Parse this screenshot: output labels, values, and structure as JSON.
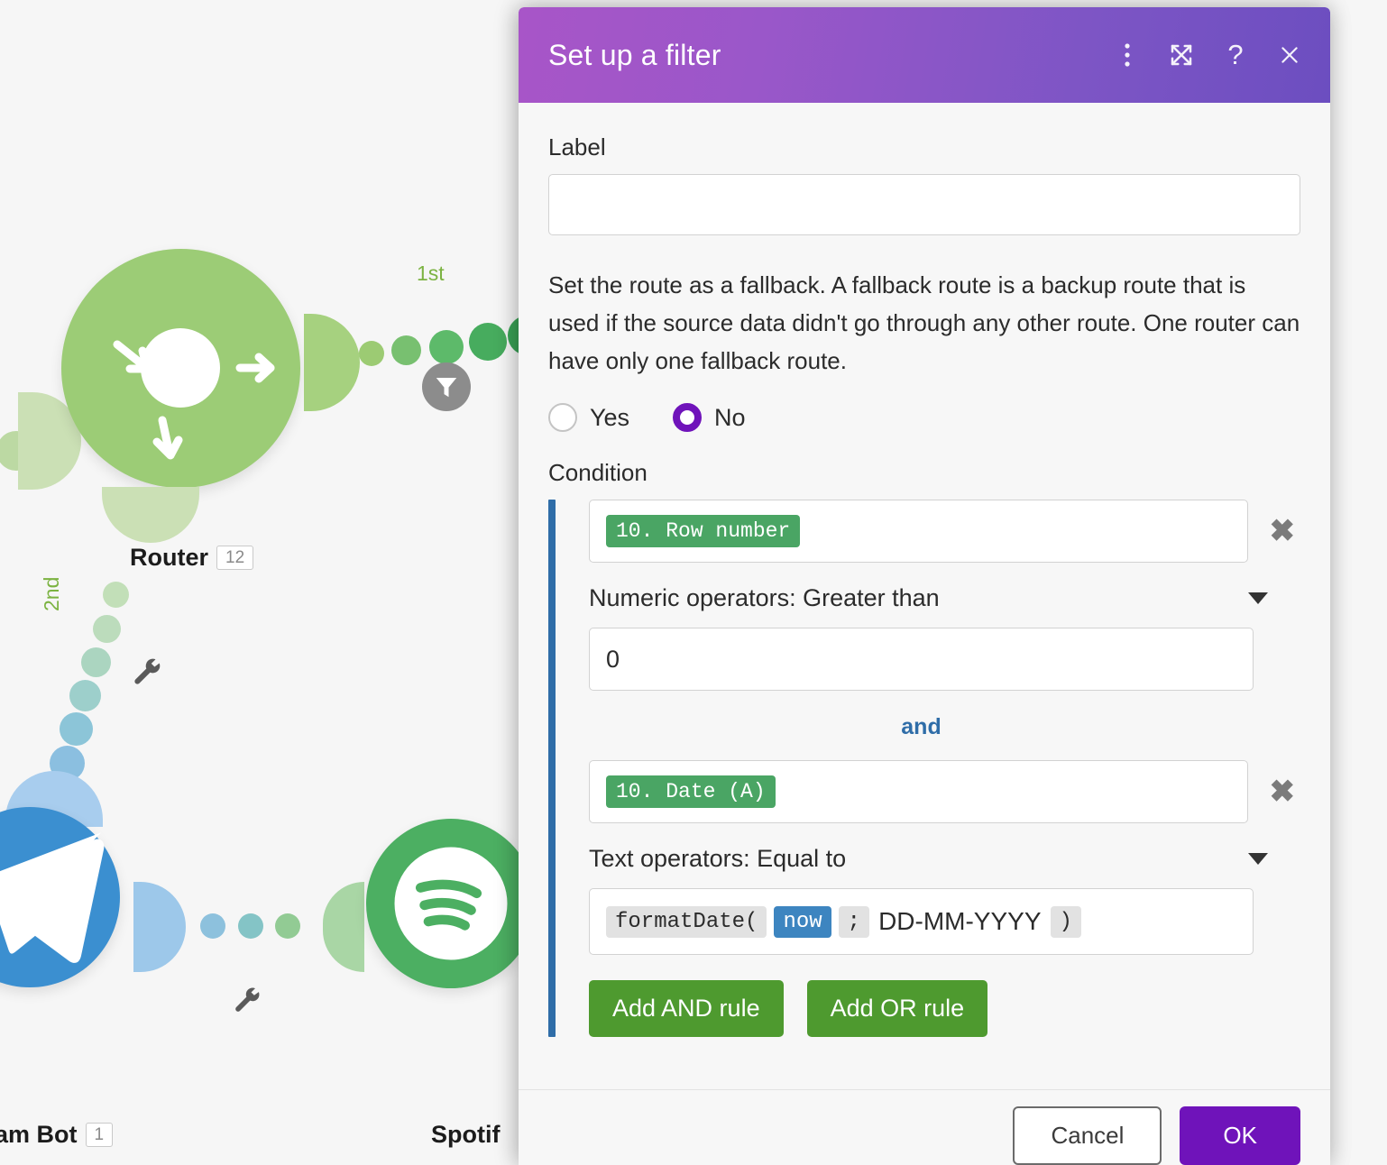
{
  "canvas": {
    "modules": [
      {
        "name": "Router",
        "count": "12",
        "type": "router"
      },
      {
        "name": "am Bot",
        "count": "1",
        "type": "telegram-bot"
      },
      {
        "name": "Spotif",
        "count": "",
        "type": "spotify"
      }
    ],
    "route_labels": [
      "1st",
      "2nd"
    ],
    "filter_icon": "filter-funnel-icon",
    "wrench_icon": "wrench-icon"
  },
  "dialog": {
    "title": "Set up a filter",
    "header_icons": [
      {
        "name": "more-options-icon",
        "glyph": "⋮"
      },
      {
        "name": "expand-icon",
        "glyph": "expand"
      },
      {
        "name": "help-icon",
        "glyph": "?"
      },
      {
        "name": "close-icon",
        "glyph": "×"
      }
    ],
    "label_field": {
      "label": "Label",
      "value": "",
      "placeholder": ""
    },
    "fallback": {
      "description": "Set the route as a fallback. A fallback route is a backup route that is used if the source data didn't go through any other route. One router can have only one fallback route.",
      "options": [
        {
          "label": "Yes",
          "selected": false
        },
        {
          "label": "No",
          "selected": true
        }
      ]
    },
    "condition": {
      "label": "Condition",
      "separator": "and",
      "rules": [
        {
          "field_tag": "10. Row number",
          "operator": "Numeric operators: Greater than",
          "value": "0",
          "remove_label": "✖"
        },
        {
          "field_tag": "10. Date (A)",
          "operator": "Text operators: Equal to",
          "formula": [
            {
              "kind": "fn",
              "text": "formatDate("
            },
            {
              "kind": "var",
              "text": "now"
            },
            {
              "kind": "sep",
              "text": ";"
            },
            {
              "kind": "plain",
              "text": "DD-MM-YYYY"
            },
            {
              "kind": "paren",
              "text": ")"
            }
          ],
          "remove_label": "✖"
        }
      ],
      "add_and_label": "Add AND rule",
      "add_or_label": "Add OR rule"
    },
    "footer": {
      "cancel_label": "Cancel",
      "ok_label": "OK"
    },
    "colors": {
      "header_gradient_start": "#a855c8",
      "header_gradient_end": "#6c4ec0",
      "accent_purple": "#6f13ba",
      "condition_bar_blue": "#2f6da8",
      "tag_green": "#4aa564",
      "button_green": "#4e9a2f",
      "variable_blue": "#3d85c0"
    }
  }
}
